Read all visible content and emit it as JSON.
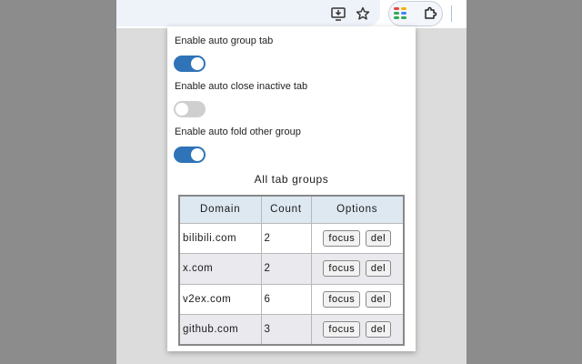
{
  "toolbar": {
    "icons": [
      "install-app-icon",
      "star-icon",
      "tab-groups-extension-icon",
      "puzzle-extensions-icon"
    ]
  },
  "settings": [
    {
      "label": "Enable auto group tab",
      "enabled": true
    },
    {
      "label": "Enable auto close inactive tab",
      "enabled": false
    },
    {
      "label": "Enable auto fold other group",
      "enabled": true
    }
  ],
  "groups": {
    "title": "All tab groups",
    "headers": {
      "domain": "Domain",
      "count": "Count",
      "options": "Options"
    },
    "rows": [
      {
        "domain": "bilibili.com",
        "count": "2",
        "focus": "focus",
        "del": "del"
      },
      {
        "domain": "x.com",
        "count": "2",
        "focus": "focus",
        "del": "del"
      },
      {
        "domain": "v2ex.com",
        "count": "6",
        "focus": "focus",
        "del": "del"
      },
      {
        "domain": "github.com",
        "count": "3",
        "focus": "focus",
        "del": "del"
      }
    ]
  },
  "colors": {
    "toggle_on": "#2f73b8",
    "toggle_off": "#cfcfcf",
    "header_bg": "#dde8f1",
    "alt_row_bg": "#e9e9ee"
  }
}
